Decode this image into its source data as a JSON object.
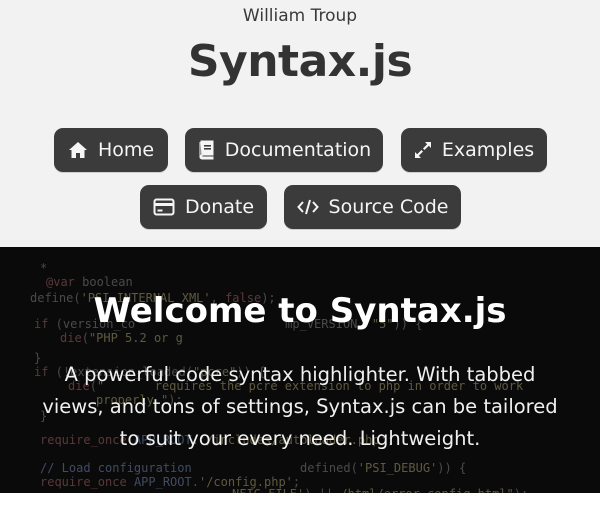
{
  "header": {
    "author": "William Troup",
    "title": "Syntax.js"
  },
  "nav": {
    "home": {
      "label": "Home",
      "icon": "home-icon"
    },
    "documentation": {
      "label": "Documentation",
      "icon": "book-icon"
    },
    "examples": {
      "label": "Examples",
      "icon": "expand-arrows-icon"
    },
    "donate": {
      "label": "Donate",
      "icon": "credit-card-icon"
    },
    "source": {
      "label": "Source Code",
      "icon": "code-icon"
    }
  },
  "hero": {
    "title": "Welcome to Syntax.js",
    "text": "A powerful code syntax highlighter. With tabbed views, and tons of settings, Syntax.js can be tailored to suit your every need. Lightweight."
  }
}
